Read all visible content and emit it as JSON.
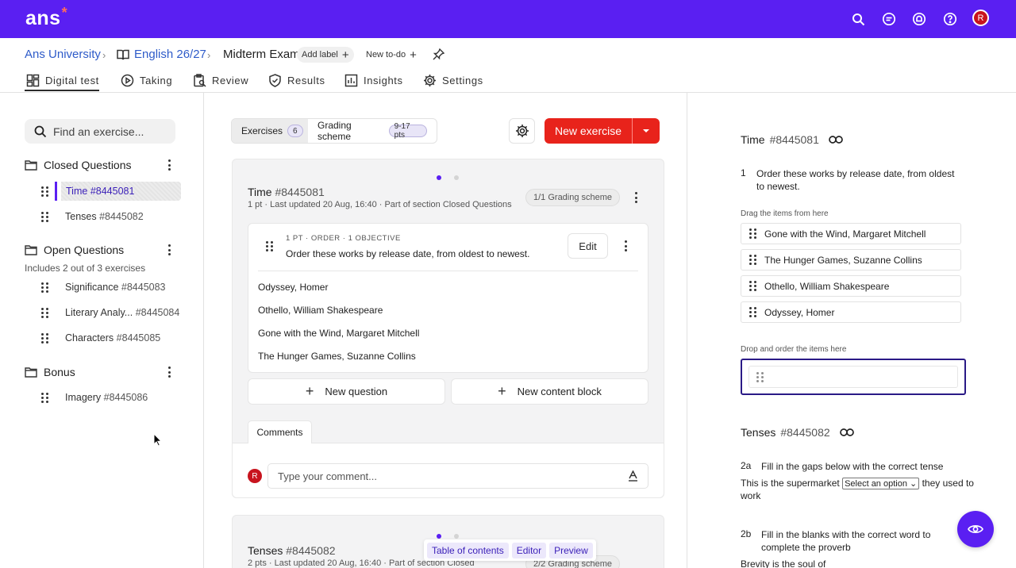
{
  "app": {
    "logo": "ans"
  },
  "colors": {
    "brand": "#5a1ff2",
    "danger": "#e8231b",
    "link": "#2e5bc9"
  },
  "topbar_icons": [
    "search-icon",
    "chat-icon",
    "bell-icon",
    "help-icon"
  ],
  "user": {
    "initial": "R"
  },
  "breadcrumb": {
    "org": "Ans University",
    "course": "English 26/27",
    "page": "Midterm Exam",
    "add_label": "Add label",
    "new_todo": "New to-do"
  },
  "tabs": [
    {
      "label": "Digital test",
      "icon": "grid-icon"
    },
    {
      "label": "Taking",
      "icon": "play-icon"
    },
    {
      "label": "Review",
      "icon": "clipboard-icon"
    },
    {
      "label": "Results",
      "icon": "shield-check-icon"
    },
    {
      "label": "Insights",
      "icon": "chart-icon"
    },
    {
      "label": "Settings",
      "icon": "gear-icon"
    }
  ],
  "sidebar": {
    "search_placeholder": "Find an exercise...",
    "sections": [
      {
        "name": "Closed Questions",
        "items": [
          {
            "name": "Time",
            "id": "#8445081",
            "active": true
          },
          {
            "name": "Tenses",
            "id": "#8445082"
          }
        ]
      },
      {
        "name": "Open Questions",
        "note": "Includes 2 out of 3 exercises",
        "items": [
          {
            "name": "Significance",
            "id": "#8445083"
          },
          {
            "name": "Literary Analy...",
            "id": "#8445084"
          },
          {
            "name": "Characters",
            "id": "#8445085"
          }
        ]
      },
      {
        "name": "Bonus",
        "items": [
          {
            "name": "Imagery",
            "id": "#8445086"
          }
        ]
      }
    ]
  },
  "editor": {
    "toggle": {
      "exercises_label": "Exercises",
      "exercises_count": "6",
      "grading_label": "Grading scheme",
      "grading_badge": "9-17 pts"
    },
    "new_exercise": "New exercise",
    "exercise": {
      "title": "Time",
      "id": "#8445081",
      "meta": "1 pt · Last updated 20 Aug, 16:40 · Part of section Closed Questions",
      "grading_chip": "1/1 Grading scheme",
      "question_meta": "1 PT · ORDER · 1 OBJECTIVE",
      "question_text": "Order these works by release date, from oldest to newest.",
      "edit_label": "Edit",
      "options": [
        "Odyssey, Homer",
        "Othello, William Shakespeare",
        "Gone with the Wind, Margaret Mitchell",
        "The Hunger Games, Suzanne Collins"
      ],
      "new_question": "New question",
      "new_content_block": "New content block",
      "comments_tab": "Comments",
      "comment_placeholder": "Type your comment..."
    },
    "exercise2": {
      "title": "Tenses",
      "id": "#8445082",
      "meta": "2 pts · Last updated 20 Aug, 16:40 · Part of section Closed",
      "grading_chip": "2/2 Grading scheme"
    },
    "floating_nav": [
      "Table of contents",
      "Editor",
      "Preview"
    ]
  },
  "preview": {
    "ex1": {
      "title": "Time",
      "id": "#8445081",
      "q_num": "1",
      "q_text": "Order these works by release date, from oldest to newest.",
      "drag_label": "Drag the items from here",
      "items": [
        "Gone with the Wind, Margaret Mitchell",
        "The Hunger Games, Suzanne Collins",
        "Othello, William Shakespeare",
        "Odyssey, Homer"
      ],
      "drop_label": "Drop and order the items here"
    },
    "ex2": {
      "title": "Tenses",
      "id": "#8445082",
      "q2a_num": "2a",
      "q2a_text": "Fill in the gaps below with the correct tense",
      "sentence_before": "This is the supermarket",
      "select_value": "Select an option",
      "sentence_after": "they used to",
      "sentence_end": "work",
      "q2b_num": "2b",
      "q2b_text": "Fill in the blanks with the correct word to complete the proverb",
      "proverb_start": "Brevity is the soul of"
    }
  }
}
